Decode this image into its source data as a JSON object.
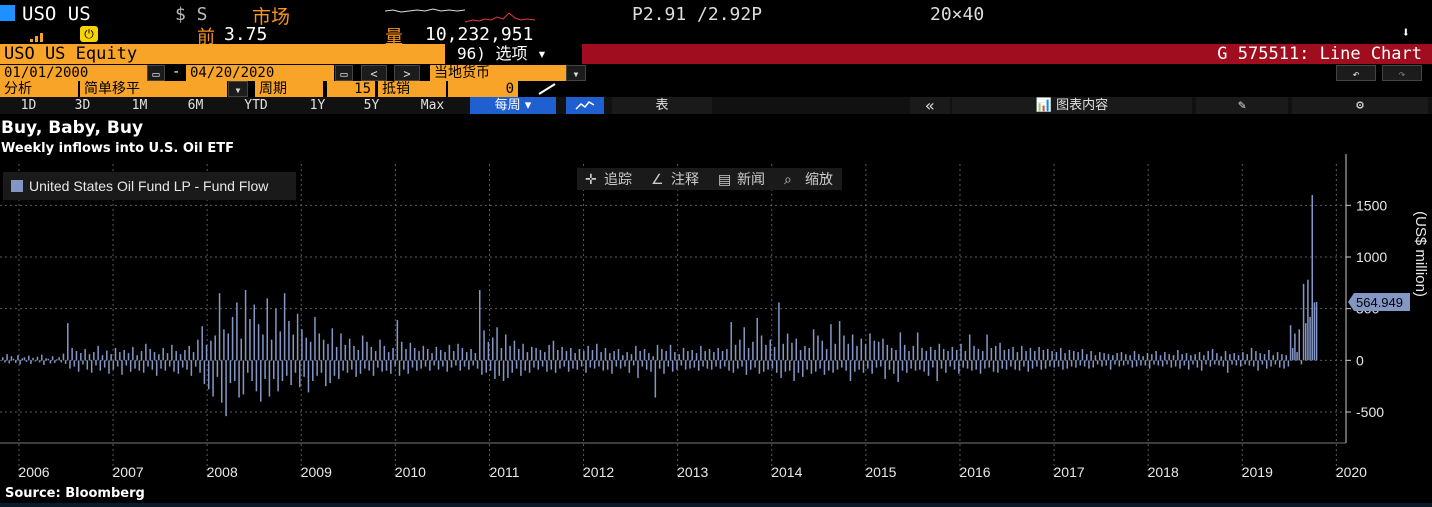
{
  "quote": {
    "ticker": "USO US",
    "currency": "$ S",
    "market": "市场",
    "prev_label": "前",
    "prev_value": "3.75",
    "volume_label": "量",
    "volume": "10,232,951",
    "bid_ask": "P2.91 /2.92P",
    "size": "20×40"
  },
  "security_bar": {
    "name": "USO US Equity",
    "options": "96) 选项 ▾",
    "title": "G 575511: Line Chart"
  },
  "date_range": {
    "start": "01/01/2000",
    "sep": "-",
    "end": "04/20/2020",
    "prev": "<",
    "next": ">",
    "currency": "当地货币",
    "dropdown": "▾"
  },
  "analysis": {
    "label": "分析",
    "method": "简单移平",
    "period_label": "周期",
    "period": "15",
    "offset_label": "抵销",
    "offset": "0"
  },
  "period_tabs": [
    "1D",
    "3D",
    "1M",
    "6M",
    "YTD",
    "1Y",
    "5Y",
    "Max"
  ],
  "frequency": "每周 ▾",
  "table_label": "表",
  "collapse": "«",
  "chart_content": "图表内容",
  "chart": {
    "title": "Buy, Baby, Buy",
    "subtitle": "Weekly inflows into U.S. Oil ETF",
    "legend": "United States Oil Fund LP - Fund Flow",
    "source": "Source: Bloomberg",
    "tools": [
      "追踪",
      "注释",
      "新闻",
      "缩放"
    ]
  },
  "chart_data": {
    "type": "bar",
    "title": "Buy, Baby, Buy",
    "subtitle": "Weekly inflows into U.S. Oil ETF",
    "ylabel": "(US$ million)",
    "ylim": [
      -800,
      1900
    ],
    "yticks": [
      -500,
      0,
      500,
      1000,
      1500
    ],
    "ytick_labels": [
      "-500",
      "0",
      "500",
      "1000",
      "1500"
    ],
    "x_year_labels": [
      "2006",
      "2007",
      "2008",
      "2009",
      "2010",
      "2011",
      "2012",
      "2013",
      "2014",
      "2015",
      "2016",
      "2017",
      "2018",
      "2019",
      "2020"
    ],
    "last_value_label": "564.949",
    "last_value": 564.949,
    "color": "#8396c4",
    "series": [
      {
        "name": "United States Oil Fund LP - Fund Flow",
        "start_year": 2005.0,
        "step_years": 0.0192,
        "values": [
          30,
          -20,
          60,
          -30,
          40,
          15,
          -25,
          50,
          -40,
          20,
          30,
          -15,
          45,
          -35,
          25,
          -10,
          35,
          -20,
          55,
          -45,
          20,
          15,
          -30,
          40,
          -25,
          10,
          30,
          -20,
          65,
          -35,
          360,
          -80,
          120,
          -60,
          90,
          -110,
          70,
          -40,
          110,
          -90,
          60,
          -120,
          80,
          -50,
          140,
          -100,
          50,
          -70,
          95,
          -130,
          60,
          -90,
          120,
          -60,
          80,
          -140,
          100,
          -50,
          70,
          -110,
          130,
          -80,
          50,
          -100,
          90,
          -120,
          160,
          -60,
          110,
          -90,
          80,
          -150,
          60,
          -80,
          120,
          -100,
          70,
          -60,
          150,
          -110,
          90,
          -130,
          60,
          -70,
          100,
          -90,
          140,
          -150,
          80,
          -60,
          200,
          -120,
          330,
          -230,
          150,
          -280,
          190,
          -350,
          240,
          -160,
          650,
          -410,
          300,
          -540,
          260,
          -220,
          420,
          -200,
          560,
          -360,
          210,
          -330,
          680,
          -120,
          400,
          -200,
          540,
          -300,
          350,
          -400,
          250,
          -180,
          600,
          -350,
          200,
          -180,
          500,
          -300,
          280,
          -200,
          650,
          -150,
          380,
          -240,
          250,
          -120,
          450,
          -260,
          300,
          -160,
          220,
          -310,
          180,
          -200,
          420,
          -150,
          260,
          -120,
          200,
          -250,
          160,
          -220,
          310,
          -150,
          130,
          -180,
          260,
          -100,
          150,
          -120,
          210,
          -90,
          140,
          -160,
          100,
          -130,
          240,
          -80,
          180,
          -100,
          130,
          -150,
          90,
          -70,
          200,
          -110,
          140,
          -100,
          80,
          -130,
          120,
          -60,
          390,
          -150,
          180,
          -90,
          110,
          -130,
          170,
          -70,
          120,
          -100,
          90,
          -80,
          140,
          -60,
          110,
          -100,
          70,
          -50,
          130,
          -90,
          100,
          -60,
          80,
          -110,
          150,
          -70,
          90,
          -50,
          160,
          -100,
          120,
          -60,
          80,
          -90,
          110,
          -50,
          70,
          -80,
          680,
          -140,
          290,
          -120,
          180,
          -100,
          220,
          -180,
          320,
          -150,
          120,
          -200,
          250,
          -170,
          140,
          -120,
          190,
          -80,
          110,
          -150,
          160,
          -100,
          80,
          -120,
          130,
          -70,
          120,
          -90,
          100,
          -60,
          80,
          -110,
          150,
          -90,
          190,
          -120,
          100,
          -80,
          130,
          -60,
          90,
          -110,
          120,
          -80,
          70,
          -90,
          110,
          -60,
          90,
          -120,
          140,
          -70,
          100,
          -80,
          160,
          -60,
          80,
          -100,
          120,
          -90,
          70,
          -130,
          90,
          -60,
          110,
          -80,
          50,
          -60,
          80,
          -120,
          60,
          -50,
          140,
          -170,
          90,
          -60,
          110,
          -90,
          70,
          -110,
          40,
          -360,
          150,
          -80,
          110,
          -130,
          90,
          -60,
          150,
          -110,
          80,
          -90,
          60,
          -50,
          120,
          -90,
          90,
          -80,
          100,
          -70,
          70,
          -100,
          140,
          -60,
          90,
          -80,
          110,
          -90,
          80,
          -60,
          120,
          -80,
          90,
          -60,
          110,
          -100,
          370,
          -120,
          150,
          -80,
          200,
          -60,
          320,
          -140,
          120,
          -90,
          180,
          -70,
          410,
          -130,
          240,
          -110,
          150,
          -90,
          200,
          -80,
          130,
          -120,
          560,
          -170,
          160,
          -110,
          260,
          -100,
          170,
          -200,
          210,
          -120,
          100,
          -160,
          140,
          -90,
          120,
          -130,
          300,
          -110,
          240,
          -80,
          190,
          -140,
          110,
          -100,
          350,
          -120,
          160,
          -90,
          380,
          -70,
          240,
          -100,
          160,
          -200,
          250,
          -110,
          140,
          -90,
          210,
          -120,
          160,
          -80,
          260,
          -130,
          190,
          -70,
          180,
          -60,
          210,
          -180,
          150,
          -90,
          120,
          -130,
          100,
          -210,
          270,
          -100,
          150,
          -120,
          90,
          -80,
          140,
          -100,
          270,
          -90,
          120,
          -110,
          90,
          -150,
          130,
          -70,
          100,
          -200,
          160,
          -80,
          110,
          -120,
          90,
          -60,
          130,
          -90,
          100,
          -130,
          160,
          -70,
          90,
          -80,
          250,
          -100,
          140,
          -90,
          110,
          -130,
          90,
          -80,
          250,
          -70,
          120,
          -110,
          140,
          -120,
          170,
          -80,
          100,
          -90,
          110,
          -60,
          130,
          -90,
          80,
          -100,
          140,
          -60,
          90,
          -110,
          120,
          -80,
          90,
          -60,
          130,
          -90,
          100,
          -80,
          110,
          -60,
          90,
          -70,
          80,
          -60,
          120,
          -90,
          70,
          -80,
          100,
          -60,
          90,
          -70,
          80,
          -50,
          110,
          -60,
          60,
          -80,
          90,
          -70,
          50,
          -40,
          80,
          -60,
          70,
          -50,
          60,
          -90,
          50,
          -40,
          70,
          -60,
          80,
          -50,
          60,
          -40,
          50,
          -70,
          90,
          -60,
          60,
          -50,
          40,
          -50,
          70,
          -80,
          60,
          -40,
          90,
          -50,
          50,
          -60,
          80,
          -40,
          60,
          -70,
          50,
          -60,
          100,
          -80,
          60,
          -50,
          70,
          -90,
          50,
          -40,
          60,
          -70,
          80,
          -100,
          50,
          -40,
          90,
          -60,
          110,
          -40,
          70,
          -50,
          40,
          -60,
          90,
          -120,
          60,
          -40,
          70,
          -50,
          50,
          -60,
          80,
          -40,
          60,
          -50,
          120,
          -60,
          90,
          -100,
          70,
          -40,
          60,
          -80,
          100,
          -60,
          50,
          -40,
          80,
          -70,
          60,
          -80,
          50,
          -60,
          340,
          120,
          260,
          80,
          300,
          -40,
          740,
          360,
          780,
          420,
          1600,
          560,
          564.949
        ]
      }
    ]
  },
  "colors": {
    "bar": "#8396c4",
    "accent_orange": "#f7a428",
    "header_red": "#a00d1f",
    "grid": "#5a5a5a",
    "label_box": "#8396c4"
  }
}
